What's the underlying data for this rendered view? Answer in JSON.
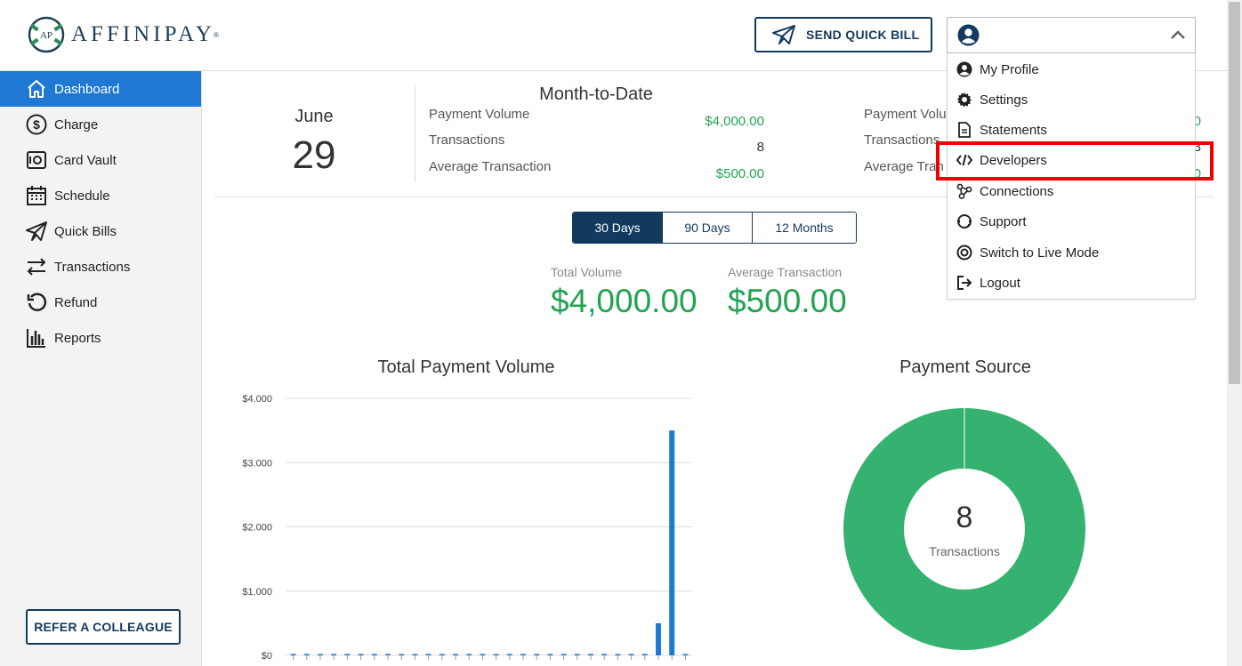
{
  "brand": {
    "name": "AFFINIPAY",
    "mark": "AP",
    "reg": "®"
  },
  "header": {
    "quick_bill_label": "SEND QUICK BILL"
  },
  "sidebar": {
    "items": [
      {
        "label": "Dashboard",
        "icon": "home-icon",
        "active": true
      },
      {
        "label": "Charge",
        "icon": "dollar-circle-icon"
      },
      {
        "label": "Card Vault",
        "icon": "vault-icon"
      },
      {
        "label": "Schedule",
        "icon": "calendar-icon"
      },
      {
        "label": "Quick Bills",
        "icon": "paper-plane-icon"
      },
      {
        "label": "Transactions",
        "icon": "transfer-arrows-icon"
      },
      {
        "label": "Refund",
        "icon": "refund-icon"
      },
      {
        "label": "Reports",
        "icon": "bar-chart-icon"
      }
    ],
    "refer_label": "REFER A COLLEAGUE"
  },
  "summary": {
    "month": "June",
    "day": "29",
    "mtd_title": "Month-to-Date",
    "rows": [
      {
        "label": "Payment Volume",
        "value": "$4,000.00"
      },
      {
        "label": "Transactions",
        "value": "8"
      },
      {
        "label": "Average Transaction",
        "value": "$500.00"
      }
    ],
    "right_rows": [
      {
        "label": "Payment Volu",
        "value": "0"
      },
      {
        "label": "Transactions",
        "value": "3"
      },
      {
        "label": "Average Tran",
        "value": "0"
      }
    ]
  },
  "ranges": [
    {
      "label": "30 Days",
      "active": true
    },
    {
      "label": "90 Days",
      "active": false
    },
    {
      "label": "12 Months",
      "active": false
    }
  ],
  "kpis": {
    "total_volume_label": "Total Volume",
    "total_volume": "$4,000.00",
    "avg_label": "Average Transaction",
    "avg_value": "$500.00"
  },
  "charts_text": {
    "volume_title": "Total Payment Volume",
    "source_title": "Payment Source",
    "donut_count": "8",
    "donut_label": "Transactions"
  },
  "chart_data": [
    {
      "type": "bar",
      "title": "Total Payment Volume",
      "y_ticks": [
        "$4.000",
        "$3.000",
        "$2.000",
        "$1.000",
        "$0"
      ],
      "ylim": [
        0,
        4000
      ],
      "grid": true,
      "categories_count": 30,
      "values": [
        0,
        0,
        0,
        0,
        0,
        0,
        0,
        0,
        0,
        0,
        0,
        0,
        0,
        0,
        0,
        0,
        0,
        0,
        0,
        0,
        0,
        0,
        0,
        0,
        0,
        0,
        0,
        500,
        3500,
        0
      ]
    },
    {
      "type": "pie",
      "title": "Payment Source",
      "center_value": "8",
      "center_label": "Transactions",
      "slices": [
        {
          "value": 8,
          "color": "#35b26f"
        }
      ]
    }
  ],
  "user_menu": {
    "items": [
      {
        "label": "My Profile",
        "icon": "user-circle-icon"
      },
      {
        "label": "Settings",
        "icon": "gear-icon"
      },
      {
        "label": "Statements",
        "icon": "document-icon"
      },
      {
        "label": "Developers",
        "icon": "code-icon",
        "highlighted": true
      },
      {
        "label": "Connections",
        "icon": "connections-icon"
      },
      {
        "label": "Support",
        "icon": "support-icon"
      },
      {
        "label": "Switch to Live Mode",
        "icon": "live-mode-icon"
      },
      {
        "label": "Logout",
        "icon": "logout-icon"
      }
    ]
  },
  "colors": {
    "primary": "#1f78d1",
    "navy": "#123a5f",
    "green": "#22a352",
    "donut": "#35b26f",
    "highlight": "#ee0000"
  }
}
